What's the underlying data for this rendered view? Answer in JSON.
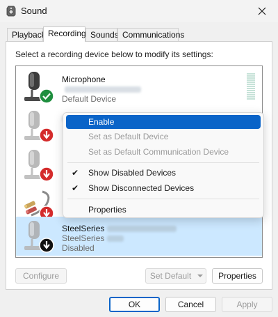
{
  "window": {
    "title": "Sound",
    "close_icon": "close-icon"
  },
  "tabs": [
    {
      "label": "Playback"
    },
    {
      "label": "Recording"
    },
    {
      "label": "Sounds"
    },
    {
      "label": "Communications"
    }
  ],
  "active_tab": "Recording",
  "instructions": "Select a recording device below to modify its settings:",
  "devices": [
    {
      "name": "Microphone",
      "line2": "",
      "line3": "Default Device",
      "status_icon": "green-check-icon",
      "selected": false
    },
    {
      "name": "",
      "line2": "",
      "line3": "",
      "status_icon": "red-down-arrow-icon",
      "selected": false
    },
    {
      "name": "",
      "line2": "",
      "line3": "",
      "status_icon": "red-down-arrow-icon",
      "selected": false
    },
    {
      "name": "",
      "line2": "",
      "line3": "",
      "status_icon": "red-down-arrow-icon",
      "selected": false
    },
    {
      "name": "SteelSeries",
      "line2": "SteelSeries",
      "line3": "Disabled",
      "status_icon": "black-down-arrow-icon",
      "selected": true
    }
  ],
  "context_menu": {
    "items": [
      {
        "label": "Enable",
        "state": "highlighted",
        "checked": false
      },
      {
        "label": "Set as Default Device",
        "state": "disabled",
        "checked": false
      },
      {
        "label": "Set as Default Communication Device",
        "state": "disabled",
        "checked": false
      },
      {
        "label": "Show Disabled Devices",
        "state": "normal",
        "checked": true
      },
      {
        "label": "Show Disconnected Devices",
        "state": "normal",
        "checked": true
      },
      {
        "label": "Properties",
        "state": "normal",
        "checked": false
      }
    ]
  },
  "buttons": {
    "configure": "Configure",
    "set_default": "Set Default",
    "properties": "Properties",
    "ok": "OK",
    "cancel": "Cancel",
    "apply": "Apply"
  },
  "colors": {
    "accent": "#0a64c8",
    "selection": "#cce8ff",
    "status_ok": "#1e8e3e",
    "status_disabled": "#d42b2b"
  }
}
